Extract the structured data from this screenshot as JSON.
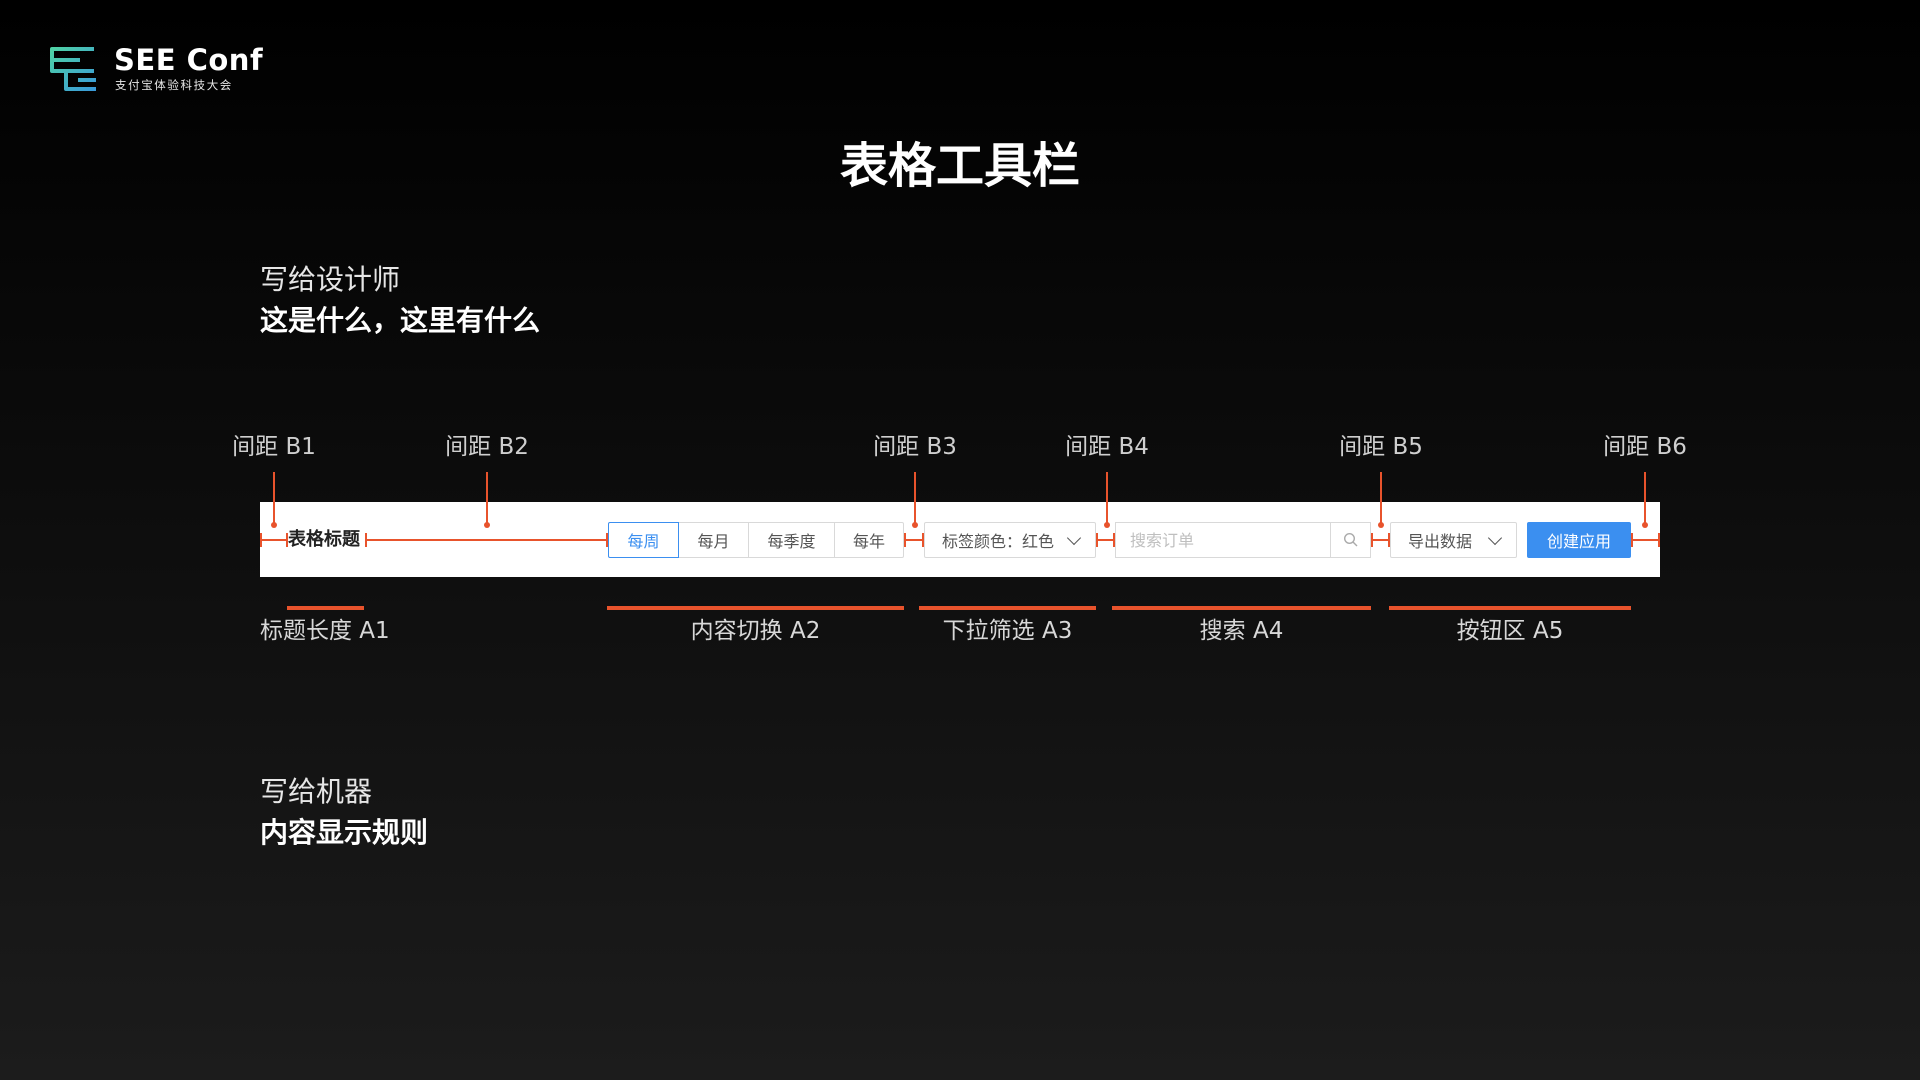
{
  "logo": {
    "name": "SEE Conf",
    "subtitle": "支付宝体验科技大会"
  },
  "slide_title": "表格工具栏",
  "designer": {
    "label": "写给设计师",
    "subtitle": "这是什么，这里有什么"
  },
  "machine": {
    "label": "写给机器",
    "subtitle": "内容显示规则"
  },
  "spacing_labels": [
    "间距 B1",
    "间距 B2",
    "间距 B3",
    "间距 B4",
    "间距 B5",
    "间距 B6"
  ],
  "area_labels": [
    "标题长度 A1",
    "内容切换 A2",
    "下拉筛选 A3",
    "搜索 A4",
    "按钮区 A5"
  ],
  "toolbar": {
    "title": "表格标题",
    "segments": [
      "每周",
      "每月",
      "每季度",
      "每年"
    ],
    "active_segment": "每周",
    "filter_label": "标签颜色：红色",
    "search_placeholder": "搜索订单",
    "export_label": "导出数据",
    "primary_label": "创建应用"
  },
  "colors": {
    "accent": "#e8532c",
    "primary_button": "#3b8ff0",
    "logo_gradient": [
      "#4fd1a5",
      "#3a9ad9"
    ]
  }
}
